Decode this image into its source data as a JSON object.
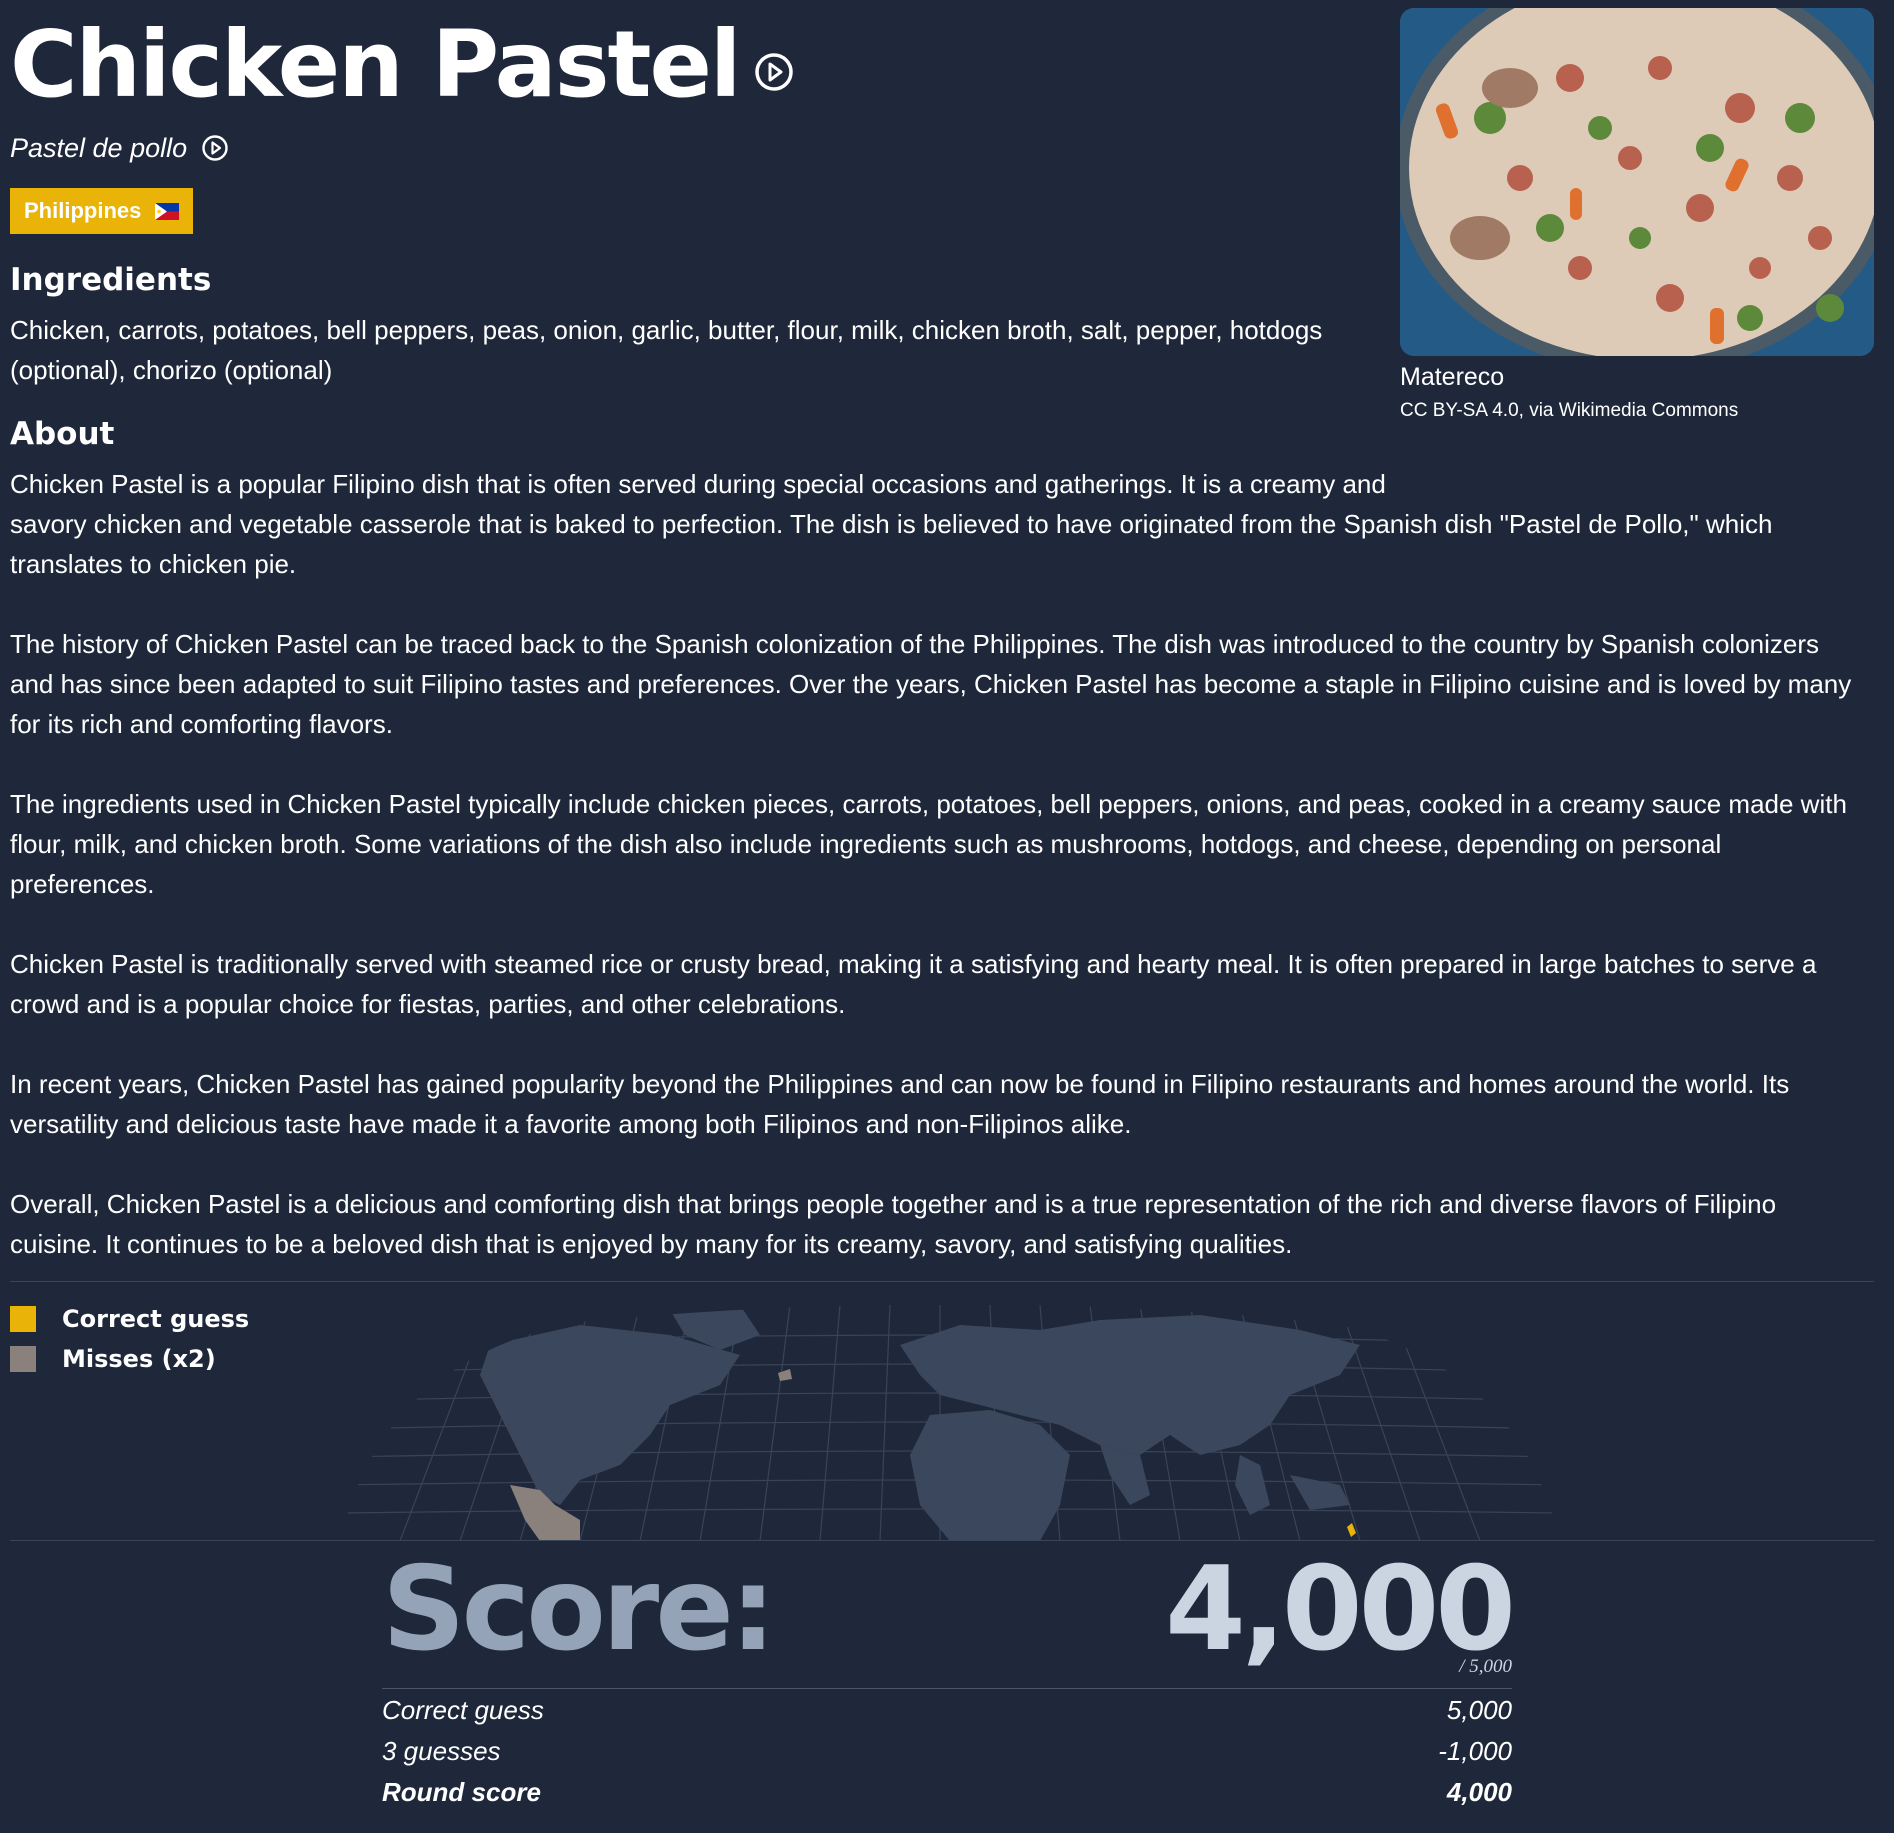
{
  "dish": {
    "title": "Chicken Pastel",
    "subtitle": "Pastel de pollo",
    "country": "Philippines"
  },
  "ingredients": {
    "heading": "Ingredients",
    "text_line1": "Chicken, carrots, potatoes, bell peppers, peas, onion, garlic, butter, flour, milk, chicken broth, salt, pepper, hotdogs",
    "text_line2": "(optional), chorizo (optional)"
  },
  "photo": {
    "credit": "Matereco",
    "license": "CC BY-SA 4.0, via Wikimedia Commons"
  },
  "about": {
    "heading": "About",
    "p1_l1": "Chicken Pastel is a popular Filipino dish that is often served during special occasions and gatherings. It is a creamy and",
    "p1_l2": "savory chicken and vegetable casserole that is baked to perfection. The dish is believed to have originated from the Spanish dish \"Pastel de Pollo,\" which",
    "p1_l3": "translates to chicken pie.",
    "p2_l1": "The history of Chicken Pastel can be traced back to the Spanish colonization of the Philippines. The dish was introduced to the country by Spanish colonizers",
    "p2_l2": "and has since been adapted to suit Filipino tastes and preferences. Over the years, Chicken Pastel has become a staple in Filipino cuisine and is loved by many",
    "p2_l3": "for its rich and comforting flavors.",
    "p3_l1": "The ingredients used in Chicken Pastel typically include chicken pieces, carrots, potatoes, bell peppers, onions, and peas, cooked in a creamy sauce made with",
    "p3_l2": "flour, milk, and chicken broth. Some variations of the dish also include ingredients such as mushrooms, hotdogs, and cheese, depending on personal",
    "p3_l3": "preferences.",
    "p4_l1": "Chicken Pastel is traditionally served with steamed rice or crusty bread, making it a satisfying and hearty meal. It is often prepared in large batches to serve a",
    "p4_l2": "crowd and is a popular choice for fiestas, parties, and other celebrations.",
    "p5_l1": "In recent years, Chicken Pastel has gained popularity beyond the Philippines and can now be found in Filipino restaurants and homes around the world. Its",
    "p5_l2": "versatility and delicious taste have made it a favorite among both Filipinos and non-Filipinos alike.",
    "p6_l1": "Overall, Chicken Pastel is a delicious and comforting dish that brings people together and is a true representation of the rich and diverse flavors of Filipino",
    "p6_l2": "cuisine. It continues to be a beloved dish that is enjoyed by many for its creamy, savory, and satisfying qualities."
  },
  "legend": {
    "correct_label": "Correct guess",
    "misses_label": "Misses (x2)",
    "correct_color": "#eab308",
    "miss_color": "#8a817c"
  },
  "score": {
    "label": "Score:",
    "value": "4,000",
    "max": "/ 5,000",
    "rows": [
      {
        "label": "Correct guess",
        "value": "5,000"
      },
      {
        "label": "3 guesses",
        "value": "-1,000"
      },
      {
        "label": "Round score",
        "value": "4,000"
      }
    ]
  }
}
